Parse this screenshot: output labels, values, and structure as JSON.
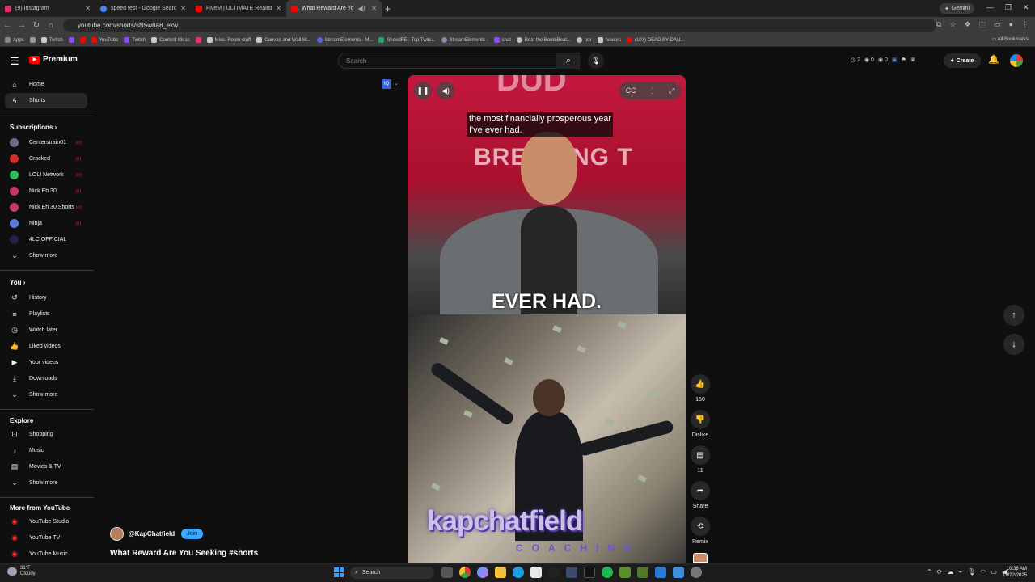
{
  "browser": {
    "tabs": [
      {
        "title": "(9) Instagram",
        "color": "#e1306c"
      },
      {
        "title": "speed test - Google Search",
        "color": "#4285f4"
      },
      {
        "title": "FiveM | ULTIMATE Realistic Gra",
        "color": "#ff0000"
      },
      {
        "title": "What Reward Are You Seek",
        "color": "#ff0000"
      }
    ],
    "gemini": "Gemini",
    "url": "youtube.com/shorts/sN5w8a8_ekw",
    "bookmarks": [
      "Apps",
      "Twitch",
      "",
      "YouTube",
      "Twitch",
      "Content Ideas",
      "",
      "Misc. Room stuff",
      "Canvas and Wall St...",
      "StreamElements - M...",
      "SheedFE - Top Twitc...",
      "StreamElements -",
      "chat",
      "Beat the BombBeat...",
      "oor",
      "houses",
      "(103) DEAD BY DAN..."
    ],
    "all_bookmarks": "All Bookmarks"
  },
  "header": {
    "logo": "Premium",
    "search_placeholder": "Search",
    "ext_counts": [
      "2",
      "0",
      "0"
    ],
    "create": "Create"
  },
  "sidebar": {
    "home": "Home",
    "shorts": "Shorts",
    "subs_title": "Subscriptions",
    "subs": [
      {
        "name": "Centerstrain01",
        "color": "#6b6b8a"
      },
      {
        "name": "Cracked",
        "color": "#d12e2e"
      },
      {
        "name": "LOL! Network",
        "color": "#2ebc5a"
      },
      {
        "name": "Nick Eh 30",
        "color": "#c7376a"
      },
      {
        "name": "Nick Eh 30 Shorts",
        "color": "#c7376a"
      },
      {
        "name": "Ninja",
        "color": "#5a7bd8"
      },
      {
        "name": "4LC OFFICIAL",
        "color": "#222244"
      }
    ],
    "show_more": "Show more",
    "you_title": "You",
    "you": [
      "History",
      "Playlists",
      "Watch later",
      "Liked videos",
      "Your videos",
      "Downloads"
    ],
    "explore_title": "Explore",
    "explore": [
      "Shopping",
      "Music",
      "Movies & TV"
    ],
    "more_title": "More from YouTube",
    "more": [
      "YouTube Studio",
      "YouTube TV",
      "YouTube Music"
    ]
  },
  "video": {
    "caption_line1": "the most financially prosperous year",
    "caption_line2": "I've ever had.",
    "big_text": "EVER HAD.",
    "bg_text": "BREAKING T",
    "watermark": "kapchatfield",
    "watermark_sub": "COACHING"
  },
  "actions": {
    "likes": "150",
    "dislike": "Dislike",
    "comments": "11",
    "share": "Share",
    "remix": "Remix"
  },
  "channel": {
    "handle": "@KapChatfield",
    "join": "Join",
    "title": "What Reward Are You Seeking #shorts"
  },
  "taskbar": {
    "temp": "31°F",
    "condition": "Cloudy",
    "search": "Search",
    "time": "10:36 AM",
    "date": "12/22/2025"
  }
}
